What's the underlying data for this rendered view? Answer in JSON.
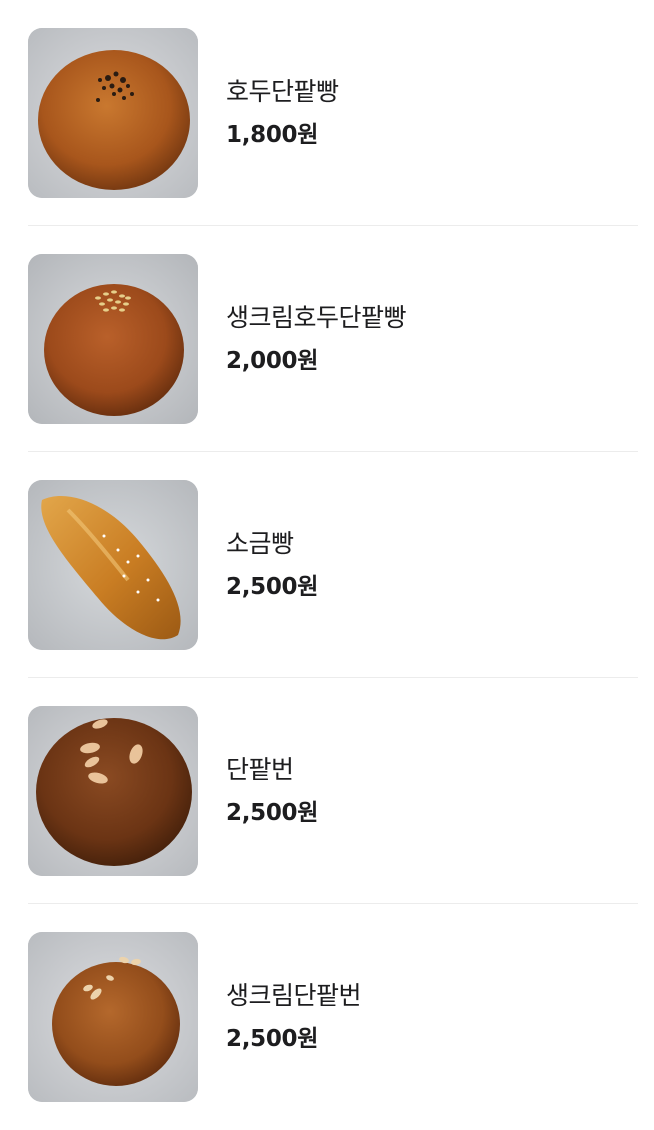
{
  "menu": {
    "items": [
      {
        "name": "호두단팥빵",
        "price": "1,800원",
        "image_icon": "red-bean-walnut-bun-photo"
      },
      {
        "name": "생크림호두단팥빵",
        "price": "2,000원",
        "image_icon": "cream-red-bean-walnut-bun-photo"
      },
      {
        "name": "소금빵",
        "price": "2,500원",
        "image_icon": "salt-bread-photo"
      },
      {
        "name": "단팥번",
        "price": "2,500원",
        "image_icon": "red-bean-bun-photo"
      },
      {
        "name": "생크림단팥번",
        "price": "2,500원",
        "image_icon": "cream-red-bean-bun-photo"
      }
    ]
  }
}
